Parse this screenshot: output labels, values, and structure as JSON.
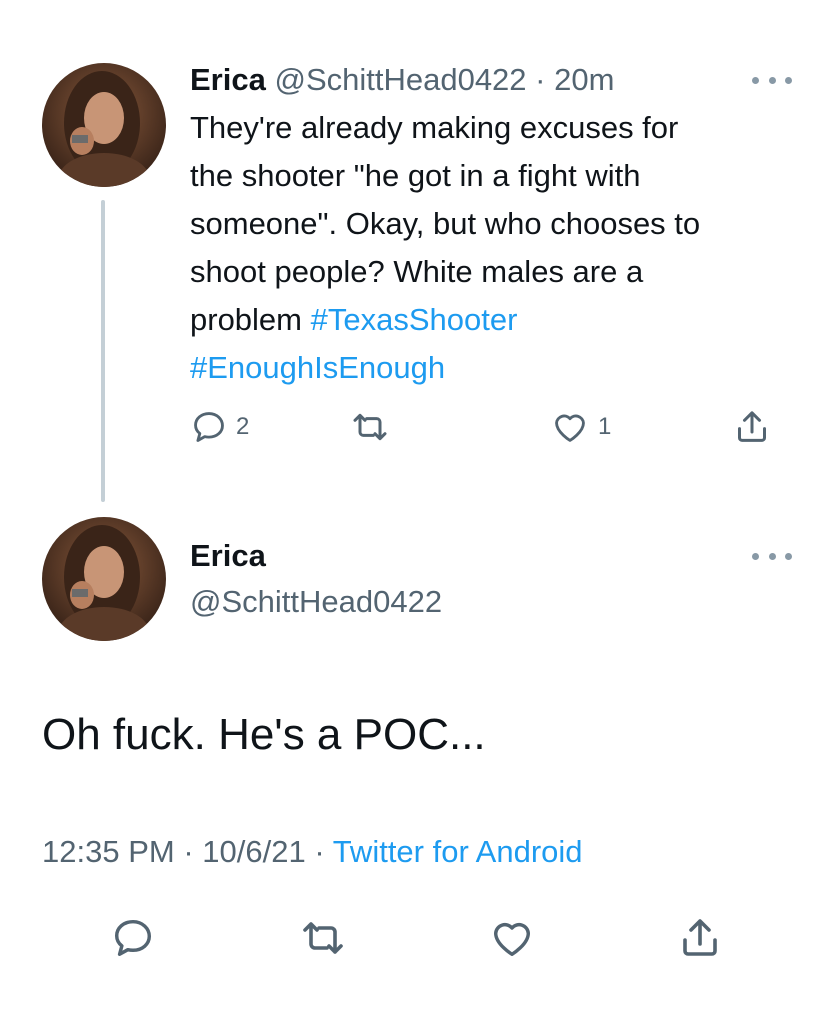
{
  "tweet1": {
    "name": "Erica",
    "handle": "@SchittHead0422",
    "separator": "·",
    "age": "20m",
    "body_lines": [
      "They're already making excuses for",
      "the shooter \"he got in a fight with",
      "someone\". Okay, but who chooses to",
      "shoot people? White males are a"
    ],
    "body_last_prefix": "problem ",
    "hashtag1": "#TexasShooter",
    "hashtag2": "#EnoughIsEnough",
    "reply_count": "2",
    "like_count": "1"
  },
  "tweet2": {
    "name": "Erica",
    "handle": "@SchittHead0422",
    "text": "Oh fuck. He's a POC...",
    "time": "12:35 PM",
    "sep1": " · ",
    "date": "10/6/21",
    "sep2": " · ",
    "source": "Twitter for Android"
  },
  "icons": {
    "reply": "reply-icon",
    "retweet": "retweet-icon",
    "like": "heart-icon",
    "share": "share-icon",
    "more": "more-dots-icon"
  },
  "colors": {
    "text": "#0f1419",
    "secondary": "#536471",
    "link": "#1d9bf0",
    "thread_line": "#c4cfd6"
  }
}
